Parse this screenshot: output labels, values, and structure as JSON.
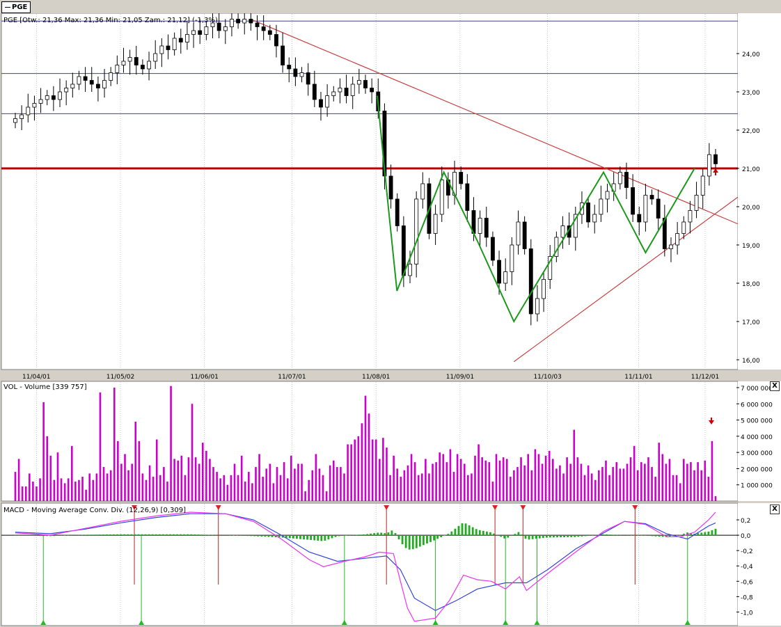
{
  "symbol_tab": "PGE",
  "price_panel": {
    "header": "PGE [Otw.: 21,36  Max: 21,36  Min: 21,05  Zam.: 21,12] (-1,3%)",
    "y_ticks": [
      "24,00",
      "23,00",
      "22,00",
      "21,00",
      "20,00",
      "19,00",
      "18,00",
      "17,00",
      "16,00"
    ],
    "x_ticks": [
      "11/04/01",
      "11/05/02",
      "11/06/01",
      "11/07/01",
      "11/08/01",
      "11/09/01",
      "11/10/03",
      "11/11/01",
      "11/12/01"
    ]
  },
  "volume_panel": {
    "header": "VOL - Volume [339 757]",
    "y_ticks": [
      "7 000 000",
      "6 000 000",
      "5 000 000",
      "4 000 000",
      "3 000 000",
      "2 000 000",
      "1 000 000"
    ],
    "close_label": "X"
  },
  "macd_panel": {
    "header": "MACD - Moving Average Conv. Div. (12,26,9) [0,309]",
    "y_ticks": [
      "0,2",
      "0,0",
      "-0,2",
      "-0,4",
      "-0,6",
      "-0,8",
      "-1,0"
    ],
    "close_label": "X"
  },
  "colors": {
    "background": "#ffffff",
    "panel_bg": "#d4d0c8",
    "volume_bar": "#cc00cc",
    "histogram": "#22aa22",
    "macd_line": "#ee33ee",
    "signal_line": "#3344dd",
    "trend_line": "#c84040",
    "resistance": "#bb0000",
    "horizontal_guides": "#404090",
    "pattern_line": "#1a9a1a"
  },
  "chart_data": [
    {
      "type": "candlestick",
      "title": "PGE [Otw.: 21,36  Max: 21,36  Min: 21,05  Zam.: 21,12] (-1,3%)",
      "y_axis": {
        "min": 15.8,
        "max": 25.0,
        "ticks": [
          24,
          23,
          22,
          21,
          20,
          19,
          18,
          17,
          16
        ]
      },
      "x_axis": {
        "ticks": [
          "11/04/01",
          "11/05/02",
          "11/06/01",
          "11/07/01",
          "11/08/01",
          "11/09/01",
          "11/10/03",
          "11/11/01",
          "11/12/01"
        ]
      },
      "close_series": [
        22.3,
        22.4,
        22.6,
        22.7,
        22.8,
        22.9,
        22.8,
        23.0,
        23.1,
        23.2,
        23.4,
        23.3,
        23.2,
        23.1,
        23.3,
        23.5,
        23.7,
        23.8,
        23.9,
        23.7,
        23.6,
        23.8,
        24.0,
        24.2,
        24.1,
        24.4,
        24.3,
        24.5,
        24.6,
        24.5,
        24.7,
        24.8,
        24.6,
        24.7,
        24.9,
        24.8,
        24.9,
        24.8,
        24.7,
        24.6,
        24.5,
        24.2,
        23.7,
        23.6,
        23.4,
        23.5,
        23.2,
        22.8,
        22.6,
        22.9,
        23.0,
        23.1,
        22.9,
        23.2,
        23.3,
        23.1,
        23.0,
        22.5,
        20.8,
        20.2,
        19.5,
        18.2,
        18.5,
        20.2,
        20.6,
        19.3,
        19.8,
        20.7,
        20.3,
        20.9,
        20.6,
        19.9,
        19.3,
        19.7,
        19.2,
        18.6,
        18.0,
        18.3,
        19.0,
        19.6,
        18.9,
        17.2,
        17.6,
        18.1,
        18.7,
        19.2,
        19.5,
        19.2,
        19.8,
        20.1,
        19.6,
        19.8,
        20.2,
        20.4,
        20.6,
        20.9,
        20.5,
        19.8,
        19.6,
        20.3,
        20.2,
        19.7,
        18.9,
        19.0,
        19.3,
        19.6,
        19.9,
        20.3,
        20.8,
        21.36,
        21.12
      ],
      "annotations": {
        "resistance": 21.0,
        "horizontal_guides": [
          24.85,
          23.48,
          22.43
        ],
        "downtrend": [
          [
            0.336,
            24.9
          ],
          [
            1.0,
            19.55
          ]
        ],
        "uptrend": [
          [
            0.712,
            15.95
          ],
          [
            1.0,
            20.25
          ]
        ],
        "pattern_points": [
          [
            0.517,
            22.9
          ],
          [
            0.527,
            21.0
          ],
          [
            0.545,
            17.8
          ],
          [
            0.612,
            20.9
          ],
          [
            0.66,
            19.1
          ],
          [
            0.712,
            17.0
          ],
          [
            0.84,
            20.9
          ],
          [
            0.9,
            18.8
          ],
          [
            0.97,
            21.0
          ]
        ]
      }
    },
    {
      "type": "bar",
      "title": "VOL - Volume [339 757]",
      "y_axis": {
        "min": 0,
        "max": 7000000
      },
      "values_millions": [
        1.8,
        2.6,
        0.9,
        0.9,
        1.7,
        1.2,
        0.9,
        1.4,
        6.1,
        4.0,
        2.8,
        1.3,
        3.0,
        1.4,
        1.1,
        1.4,
        3.4,
        1.2,
        1.3,
        1.5,
        0.7,
        1.7,
        1.3,
        1.7,
        6.7,
        2.1,
        1.7,
        1.9,
        7.0,
        3.7,
        2.3,
        2.9,
        1.9,
        2.3,
        4.9,
        3.7,
        1.7,
        1.3,
        2.2,
        1.5,
        3.8,
        1.6,
        2.1,
        1.2,
        7.1,
        2.6,
        2.5,
        2.8,
        1.6,
        2.7,
        6.0,
        2.7,
        2.3,
        3.6,
        3.1,
        2.6,
        2.1,
        1.8,
        1.4,
        1.6,
        1.0,
        1.6,
        2.3,
        1.6,
        2.8,
        1.2,
        1.8,
        1.1,
        2.1,
        2.9,
        1.5,
        2.0,
        2.3,
        1.1,
        2.1,
        1.6,
        2.4,
        1.4,
        2.8,
        2.0,
        2.3,
        2.3,
        0.6,
        1.3,
        1.9,
        2.9,
        2.0,
        1.6,
        0.6,
        2.2,
        2.5,
        2.1,
        2.1,
        1.7,
        3.5,
        3.5,
        3.8,
        4.0,
        4.8,
        6.5,
        5.4,
        3.8,
        3.8,
        2.6,
        3.9,
        3.3,
        1.6,
        2.8,
        2.0,
        1.5,
        1.9,
        2.2,
        2.9,
        2.4,
        1.6,
        1.7,
        2.6,
        1.7,
        2.3,
        2.4,
        3.0,
        2.9,
        2.4,
        3.2,
        1.8,
        2.9,
        2.6,
        2.3,
        1.6,
        1.7,
        2.8,
        3.5,
        2.7,
        2.5,
        2.4,
        1.2,
        2.9,
        2.5,
        2.7,
        2.6,
        1.5,
        1.9,
        2.1,
        2.7,
        2.2,
        2.9,
        1.9,
        3.2,
        2.9,
        2.3,
        2.8,
        3.1,
        2.6,
        2.0,
        2.2,
        1.7,
        2.7,
        2.3,
        4.4,
        2.7,
        2.3,
        1.6,
        2.2,
        1.7,
        1.3,
        1.9,
        2.1,
        2.5,
        1.6,
        2.1,
        2.4,
        2.0,
        2.0,
        2.3,
        2.7,
        3.4,
        1.9,
        2.4,
        2.3,
        2.7,
        2.1,
        1.5,
        3.6,
        2.9,
        2.3,
        2.6,
        1.6,
        1.6,
        1.1,
        2.6,
        2.3,
        2.4,
        1.9,
        2.4,
        1.9,
        2.5,
        1.5,
        3.7,
        0.3
      ]
    },
    {
      "type": "line+histogram",
      "title": "MACD - Moving Average Conv. Div. (12,26,9) [0,309]",
      "y_axis": {
        "min": -1.15,
        "max": 0.3
      },
      "series": [
        {
          "name": "MACD",
          "x": [
            0,
            0.02,
            0.05,
            0.1,
            0.15,
            0.2,
            0.25,
            0.3,
            0.34,
            0.38,
            0.42,
            0.44,
            0.47,
            0.5,
            0.52,
            0.54,
            0.55,
            0.56,
            0.57,
            0.6,
            0.62,
            0.64,
            0.66,
            0.68,
            0.7,
            0.72,
            0.73,
            0.76,
            0.8,
            0.84,
            0.87,
            0.9,
            0.93,
            0.95,
            0.97,
            0.99,
            1.0
          ],
          "values": [
            0.03,
            0.02,
            0.0,
            0.09,
            0.18,
            0.25,
            0.3,
            0.28,
            0.18,
            -0.05,
            -0.32,
            -0.41,
            -0.34,
            -0.28,
            -0.22,
            -0.24,
            -0.6,
            -0.95,
            -1.12,
            -1.08,
            -0.85,
            -0.52,
            -0.58,
            -0.6,
            -0.7,
            -0.54,
            -0.72,
            -0.5,
            -0.22,
            0.05,
            0.18,
            0.14,
            -0.02,
            -0.02,
            0.04,
            0.2,
            0.3
          ]
        },
        {
          "name": "Signal",
          "x": [
            0,
            0.05,
            0.1,
            0.15,
            0.2,
            0.25,
            0.3,
            0.34,
            0.38,
            0.42,
            0.46,
            0.5,
            0.53,
            0.55,
            0.57,
            0.6,
            0.63,
            0.66,
            0.7,
            0.73,
            0.76,
            0.8,
            0.84,
            0.87,
            0.9,
            0.93,
            0.96,
            0.99,
            1.0
          ],
          "values": [
            0.04,
            0.02,
            0.08,
            0.16,
            0.23,
            0.28,
            0.28,
            0.2,
            0.0,
            -0.22,
            -0.34,
            -0.3,
            -0.27,
            -0.45,
            -0.82,
            -0.98,
            -0.85,
            -0.7,
            -0.62,
            -0.62,
            -0.45,
            -0.18,
            0.03,
            0.18,
            0.15,
            0.02,
            -0.05,
            0.12,
            0.16
          ]
        }
      ]
    }
  ]
}
